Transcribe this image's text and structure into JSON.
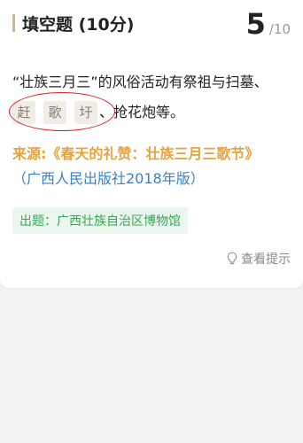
{
  "header": {
    "title": "填空题 (10分)",
    "current": "5",
    "total": "/10"
  },
  "question": {
    "line1": "“壮族三月三”的风俗活动有祭祖与扫墓、",
    "blanks": [
      "赶",
      "歌",
      "圩"
    ],
    "line2_suffix": "、抢花炮等。"
  },
  "source": {
    "label": "来源:《春天的礼赞：壮族三月三歌节》",
    "publisher": "（广西人民出版社2018年版）"
  },
  "setter": {
    "text": "出题：广西壮族自治区博物馆"
  },
  "hint": {
    "label": "查看提示",
    "icon": "lightbulb-icon"
  },
  "colors": {
    "accent_bar": "#c7b89e",
    "source_orange": "#e8a33c",
    "publisher_blue": "#3f7fc0",
    "setter_green": "#3aa757",
    "annotation_red": "#e02020"
  }
}
